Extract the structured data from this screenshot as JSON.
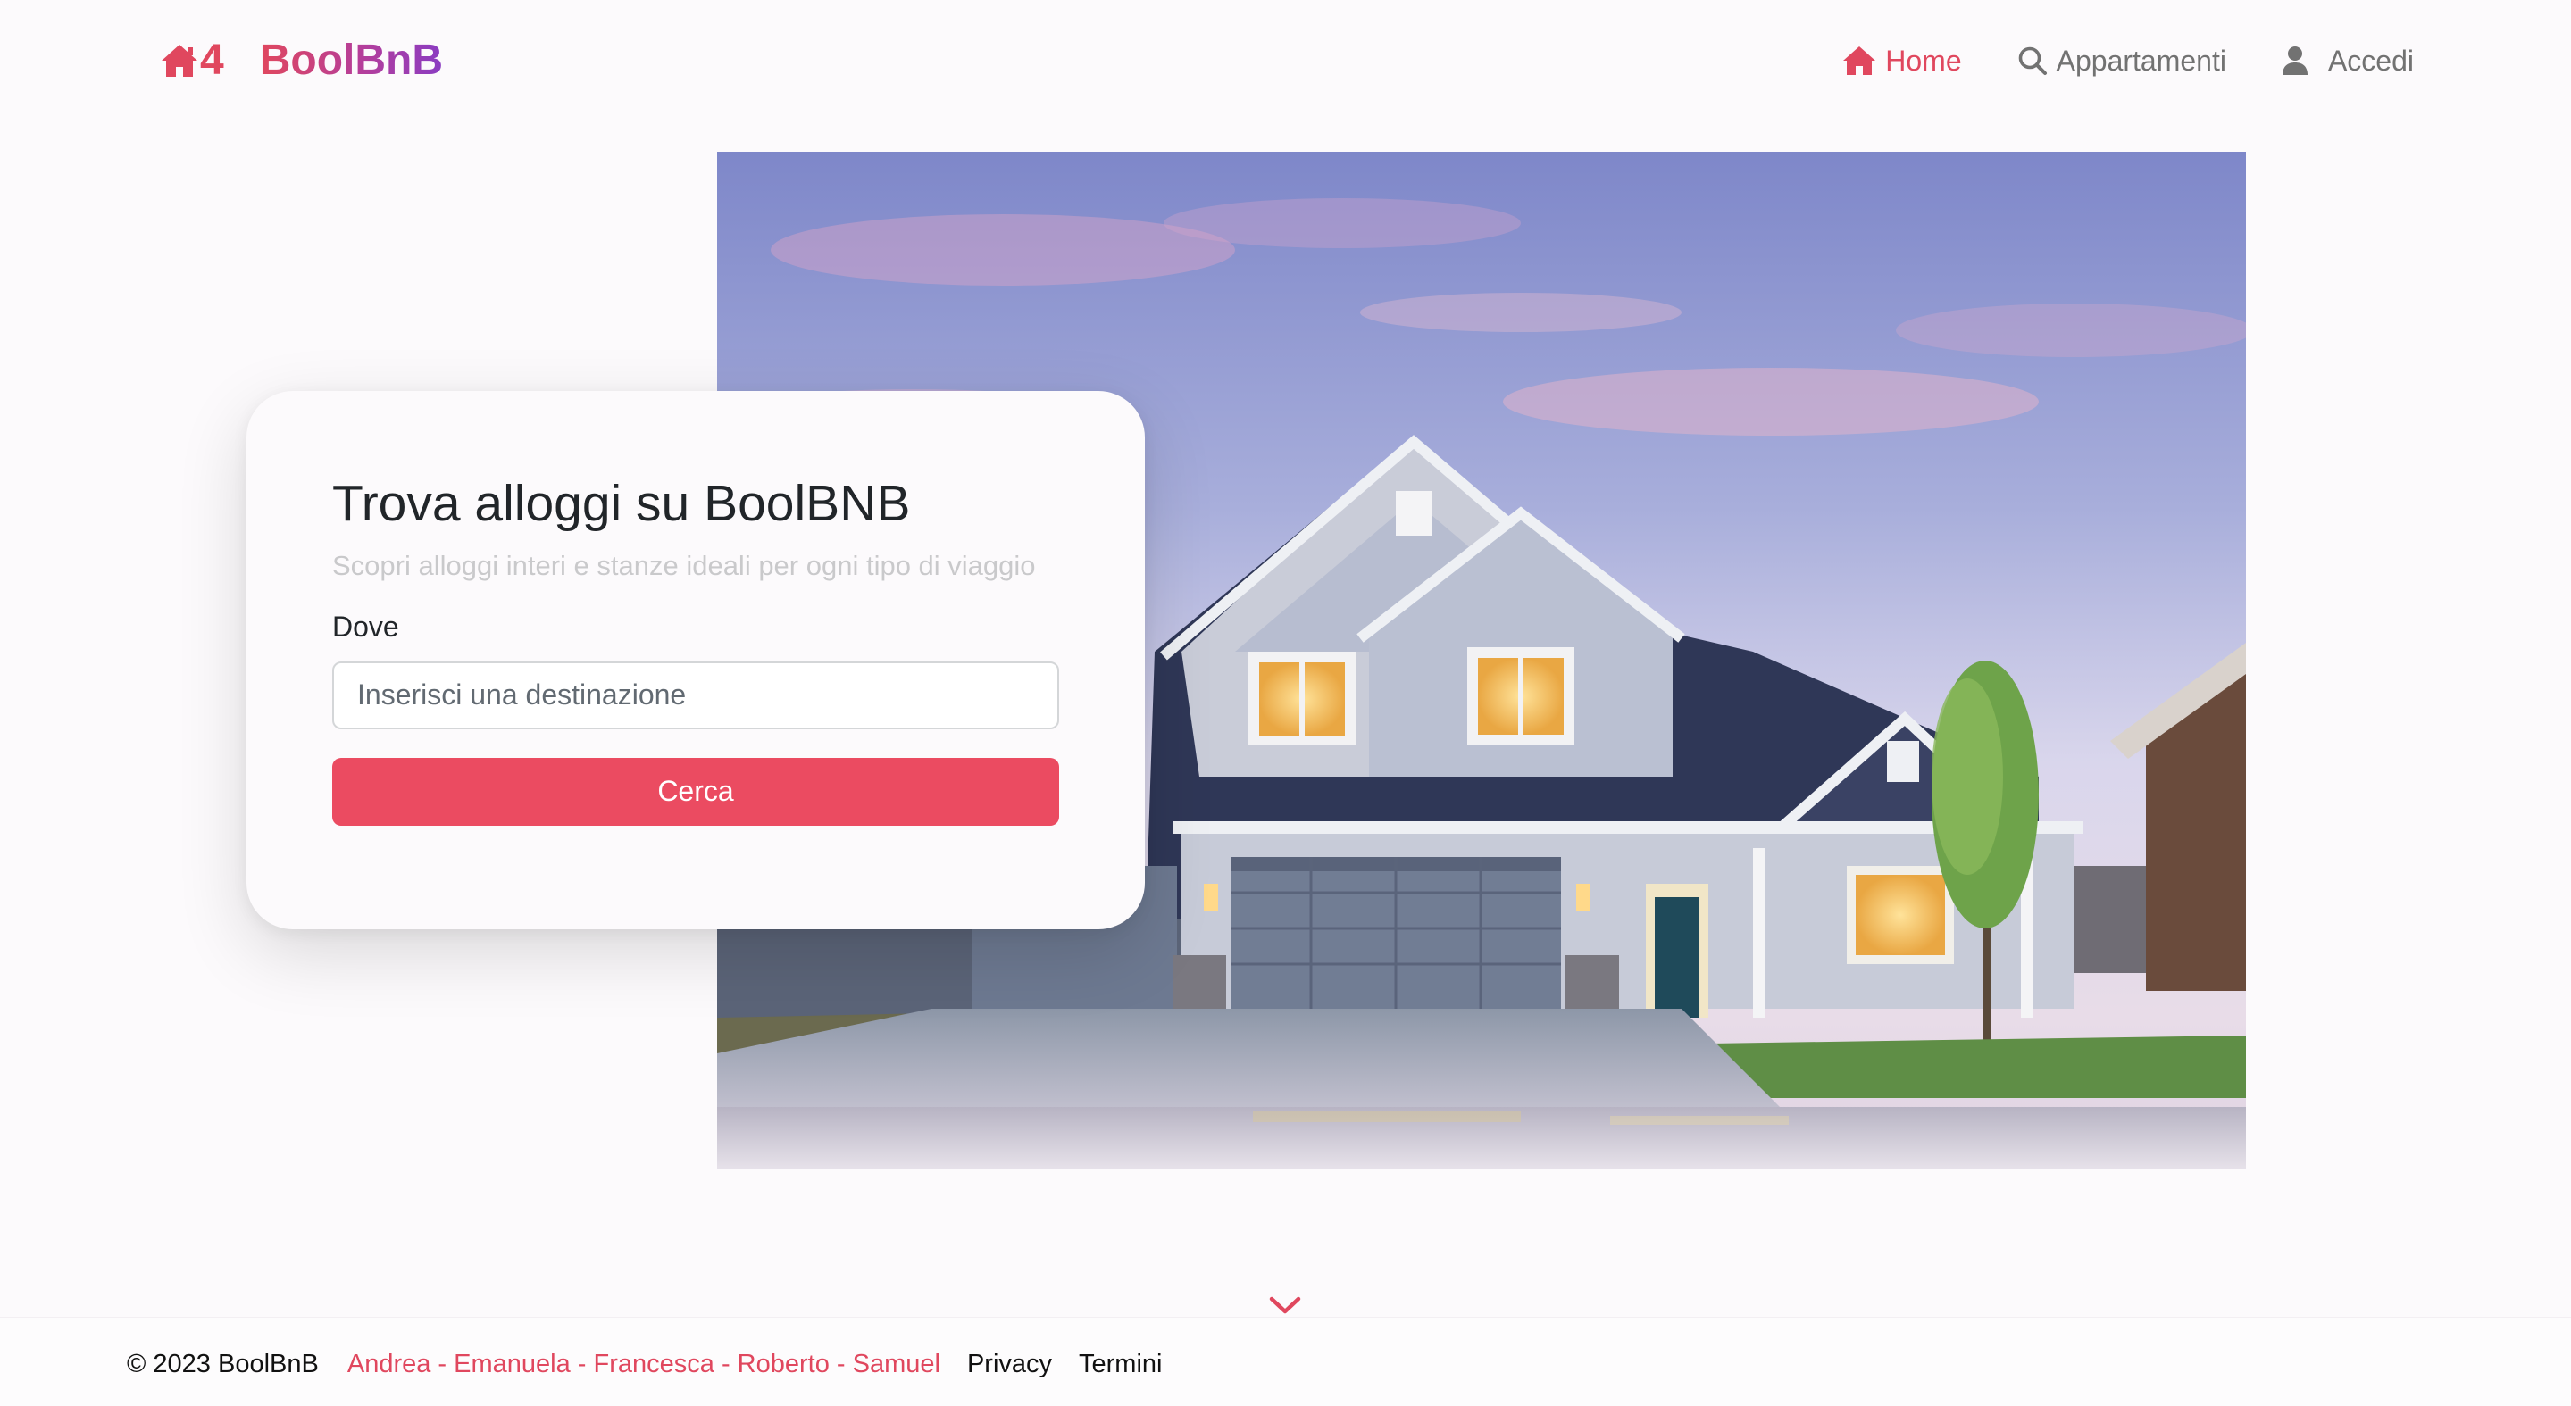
{
  "brand": {
    "logo_icon": "house-icon",
    "logo_number": "4",
    "name": "BoolBnB"
  },
  "nav": {
    "items": [
      {
        "label": "Home",
        "icon": "house-icon",
        "active": true
      },
      {
        "label": "Appartamenti",
        "icon": "search-icon",
        "active": false
      },
      {
        "label": "Accedi",
        "icon": "user-icon",
        "active": false
      }
    ]
  },
  "hero": {
    "image": "house-at-dusk-photo"
  },
  "search": {
    "title": "Trova alloggi su BoolBNB",
    "subtitle": "Scopri alloggi interi e stanze ideali per ogni tipo di viaggio",
    "label": "Dove",
    "placeholder": "Inserisci una destinazione",
    "button_label": "Cerca"
  },
  "scroll_indicator": {
    "icon": "chevron-down-icon"
  },
  "footer": {
    "copyright": "© 2023 BoolBnB",
    "authors": "Andrea - Emanuela - Francesca - Roberto - Samuel",
    "links": [
      "Privacy",
      "Termini"
    ]
  },
  "colors": {
    "accent": "#eb4b61",
    "brand_gradient": [
      "#e0475e",
      "#8a3cc2"
    ],
    "nav_text": "#727272",
    "background": "#fcfafc"
  }
}
